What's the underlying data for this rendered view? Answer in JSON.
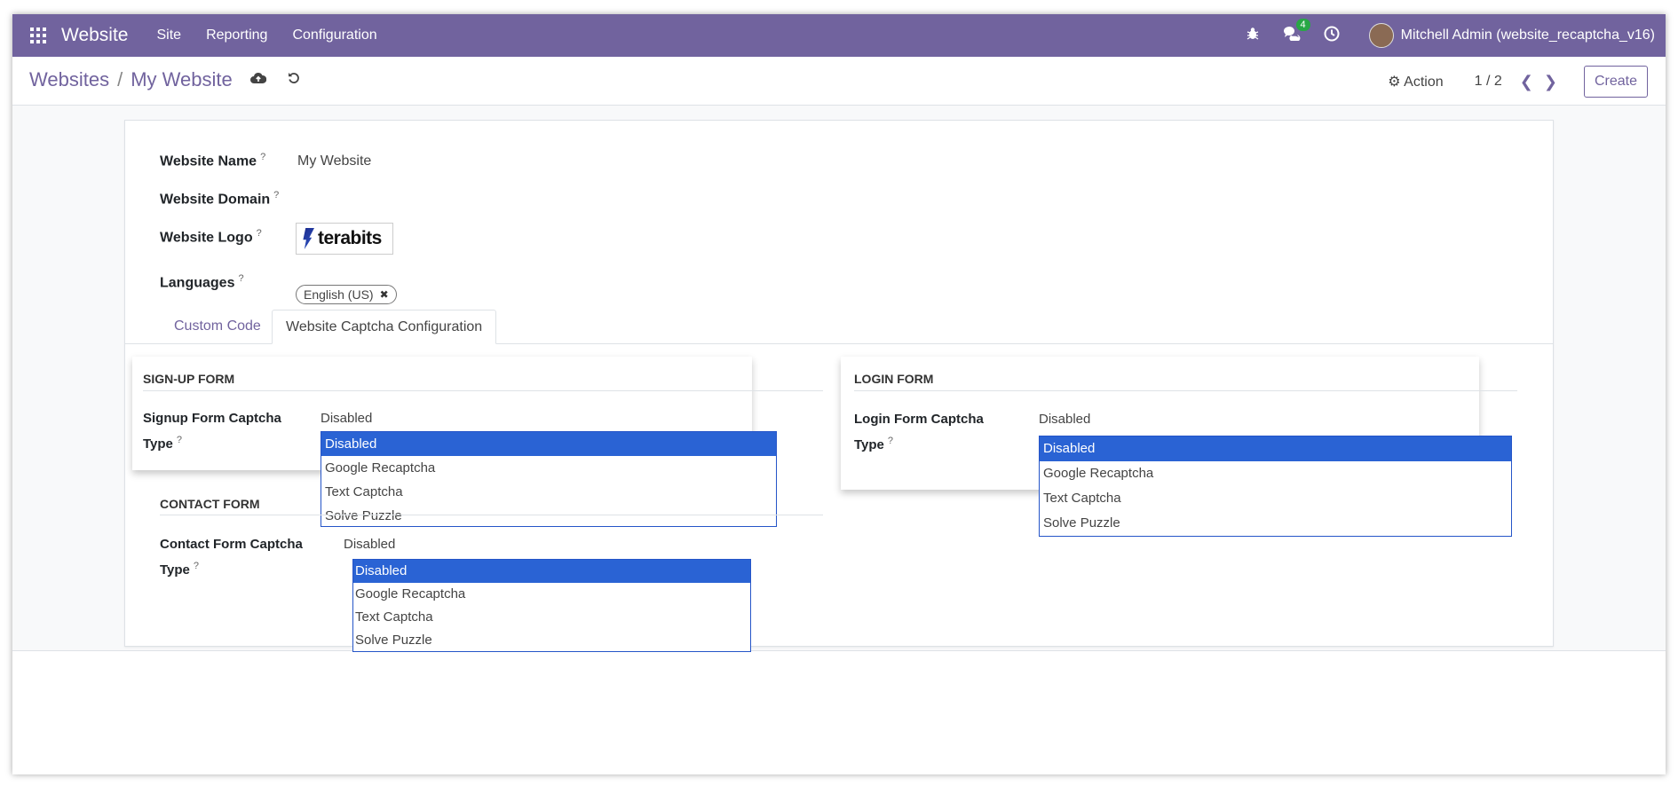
{
  "navbar": {
    "app_name": "Website",
    "menu": [
      "Site",
      "Reporting",
      "Configuration"
    ],
    "chat_count": "4",
    "user_name": "Mitchell Admin (website_recaptcha_v16)",
    "color": "#71639e"
  },
  "control": {
    "breadcrumb_parent": "Websites",
    "breadcrumb_sep": "/",
    "breadcrumb_current": "My Website",
    "action_label": "Action",
    "pager": "1 / 2",
    "create_label": "Create"
  },
  "form": {
    "website_name_label": "Website Name",
    "website_name_value": "My Website",
    "website_domain_label": "Website Domain",
    "website_logo_label": "Website Logo",
    "logo_text": "terabits",
    "languages_label": "Languages",
    "language_tag": "English (US)",
    "help_mark": "?"
  },
  "tabs": [
    "Custom Code",
    "Website Captcha Configuration"
  ],
  "captcha": {
    "signup": {
      "title": "SIGN-UP FORM",
      "label_line1": "Signup Form Captcha",
      "label_line2": "Type",
      "value": "Disabled"
    },
    "login": {
      "title": "LOGIN FORM",
      "label_line1": "Login Form Captcha",
      "label_line2": "Type",
      "value": "Disabled"
    },
    "contact": {
      "title": "CONTACT FORM",
      "label_line1": "Contact Form Captcha",
      "label_line2": "Type",
      "value": "Disabled"
    },
    "options": [
      "Disabled",
      "Google Recaptcha",
      "Text Captcha",
      "Solve Puzzle"
    ],
    "selected_option": "Disabled",
    "selected_color": "#2a63d4"
  }
}
